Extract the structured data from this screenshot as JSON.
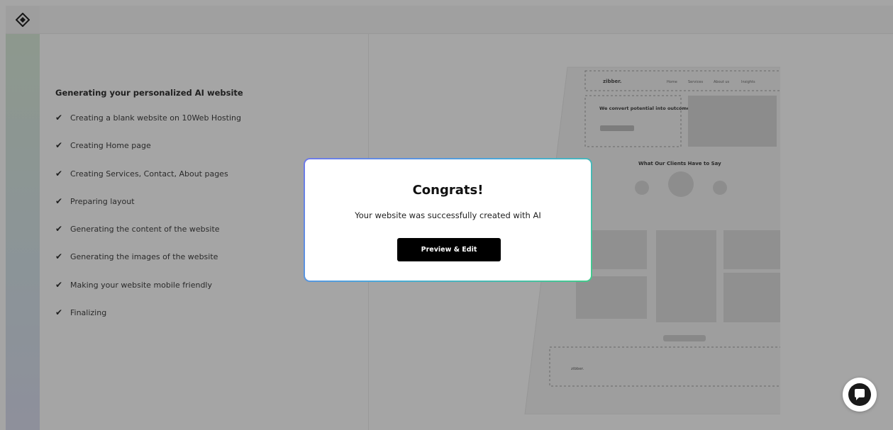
{
  "app": {
    "logo_icon": "tenweb-logo-icon"
  },
  "progress": {
    "title": "Generating your personalized AI website",
    "steps": [
      {
        "label": "Creating a blank website on 10Web Hosting",
        "status": "done"
      },
      {
        "label": "Creating Home page",
        "status": "done"
      },
      {
        "label": "Creating Services, Contact, About pages",
        "status": "done"
      },
      {
        "label": "Preparing layout",
        "status": "done"
      },
      {
        "label": "Generating the content of the website",
        "status": "done"
      },
      {
        "label": "Generating the images of the website",
        "status": "done"
      },
      {
        "label": "Making your website mobile friendly",
        "status": "done"
      },
      {
        "label": "Finalizing",
        "status": "done"
      }
    ]
  },
  "preview": {
    "brand": "zibber.",
    "nav": [
      "Home",
      "Services",
      "About us",
      "Insights"
    ],
    "hero_heading": "We convert potential into outcomes.",
    "testimonials_heading": "What Our Clients Have to Say",
    "footer_brand": "zibber."
  },
  "dialog": {
    "title": "Congrats!",
    "message": "Your website was successfully created with AI",
    "button_label": "Preview & Edit"
  },
  "chat": {
    "icon": "chat-bubble-icon"
  },
  "colors": {
    "overlay": "#1e1e1e",
    "button_bg": "#000000",
    "border_gradient": [
      "#6f79e8",
      "#4aa9d8",
      "#44c98a"
    ]
  }
}
